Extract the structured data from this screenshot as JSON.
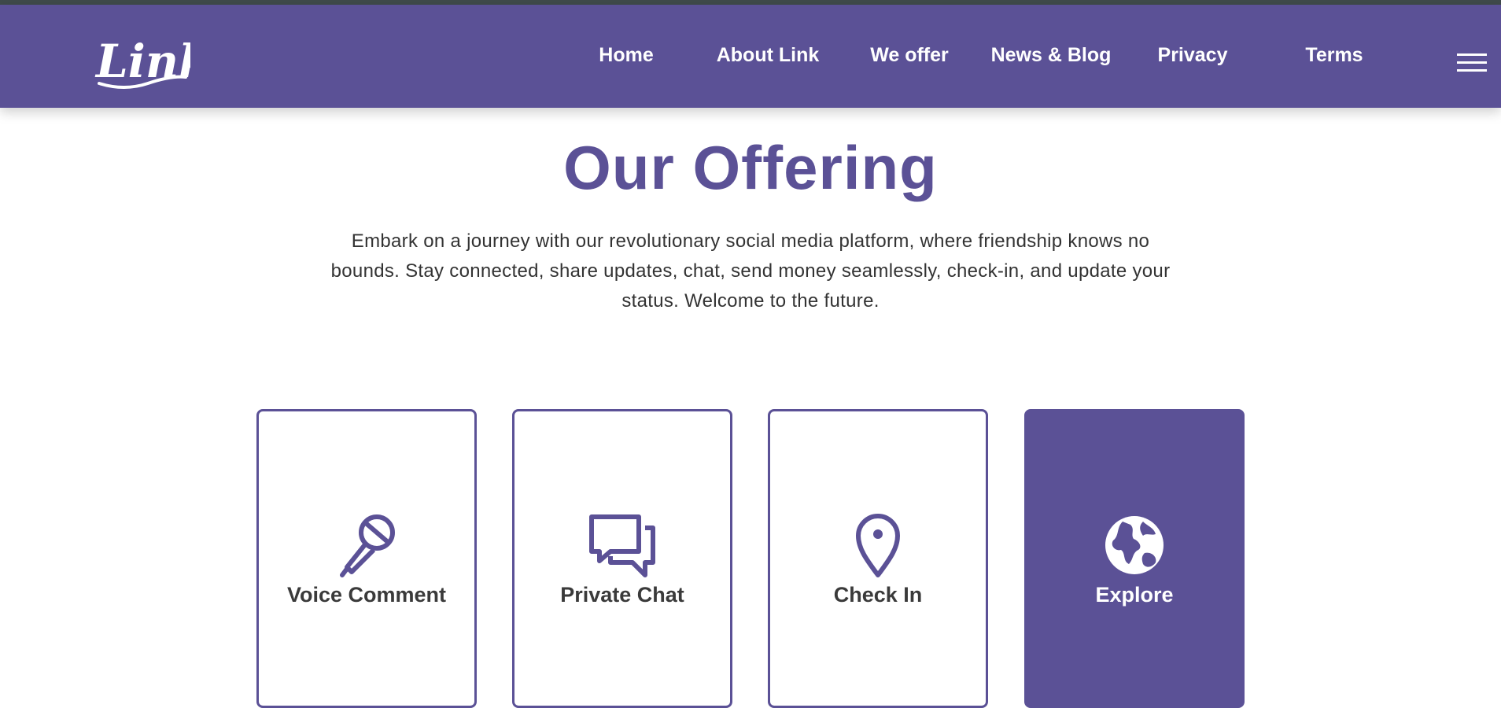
{
  "brand": {
    "logo_text": "Link",
    "primary_color": "#5b5196",
    "top_strip_color": "#3f4a4a"
  },
  "nav": {
    "items": [
      {
        "label": "Home"
      },
      {
        "label": "About Link"
      },
      {
        "label": "We offer"
      },
      {
        "label": "News & Blog"
      },
      {
        "label": "Privacy"
      },
      {
        "label": "Terms"
      }
    ],
    "menu_icon": "hamburger-icon"
  },
  "section": {
    "title": "Our Offering",
    "intro": "Embark on a journey with our revolutionary social media platform, where friendship knows no bounds. Stay connected, share updates, chat, send money seamlessly, check-in, and update your status. Welcome to the future."
  },
  "offerings": [
    {
      "label": "Voice Comment",
      "icon": "microphone-icon",
      "active": false
    },
    {
      "label": "Private Chat",
      "icon": "chat-bubbles-icon",
      "active": false
    },
    {
      "label": "Check In",
      "icon": "map-pin-icon",
      "active": false
    },
    {
      "label": "Explore",
      "icon": "globe-icon",
      "active": true
    }
  ]
}
